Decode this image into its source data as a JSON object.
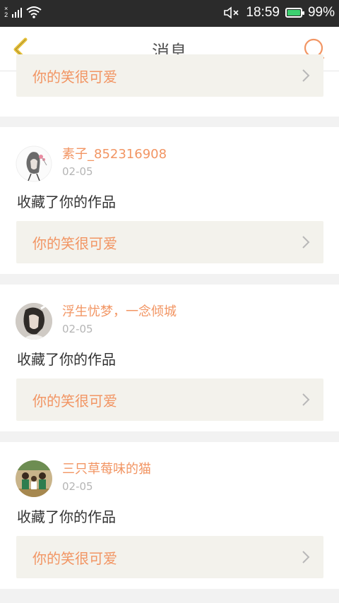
{
  "status_bar": {
    "sim_label": "2",
    "time": "18:59",
    "battery_percent": "99%",
    "battery_level": 0.99,
    "battery_color": "#3cd070"
  },
  "header": {
    "title": "消息",
    "back_icon": "chevron-left-icon",
    "search_icon": "search-icon",
    "accent": "#f29563",
    "back_color": "#e8c23a"
  },
  "notifications": [
    {
      "partial": true,
      "work_title": "你的笑很可爱"
    },
    {
      "username": "素子_852316908",
      "date": "02-05",
      "action": "收藏了你的作品",
      "work_title": "你的笑很可爱",
      "avatar": "sketch-girl-avatar"
    },
    {
      "username": "浮生忧梦，一念倾城",
      "date": "02-05",
      "action": "收藏了你的作品",
      "work_title": "你的笑很可爱",
      "avatar": "portrait-avatar"
    },
    {
      "username": "三只草莓味的猫",
      "date": "02-05",
      "action": "收藏了你的作品",
      "work_title": "你的笑很可爱",
      "avatar": "group-photo-avatar"
    }
  ]
}
